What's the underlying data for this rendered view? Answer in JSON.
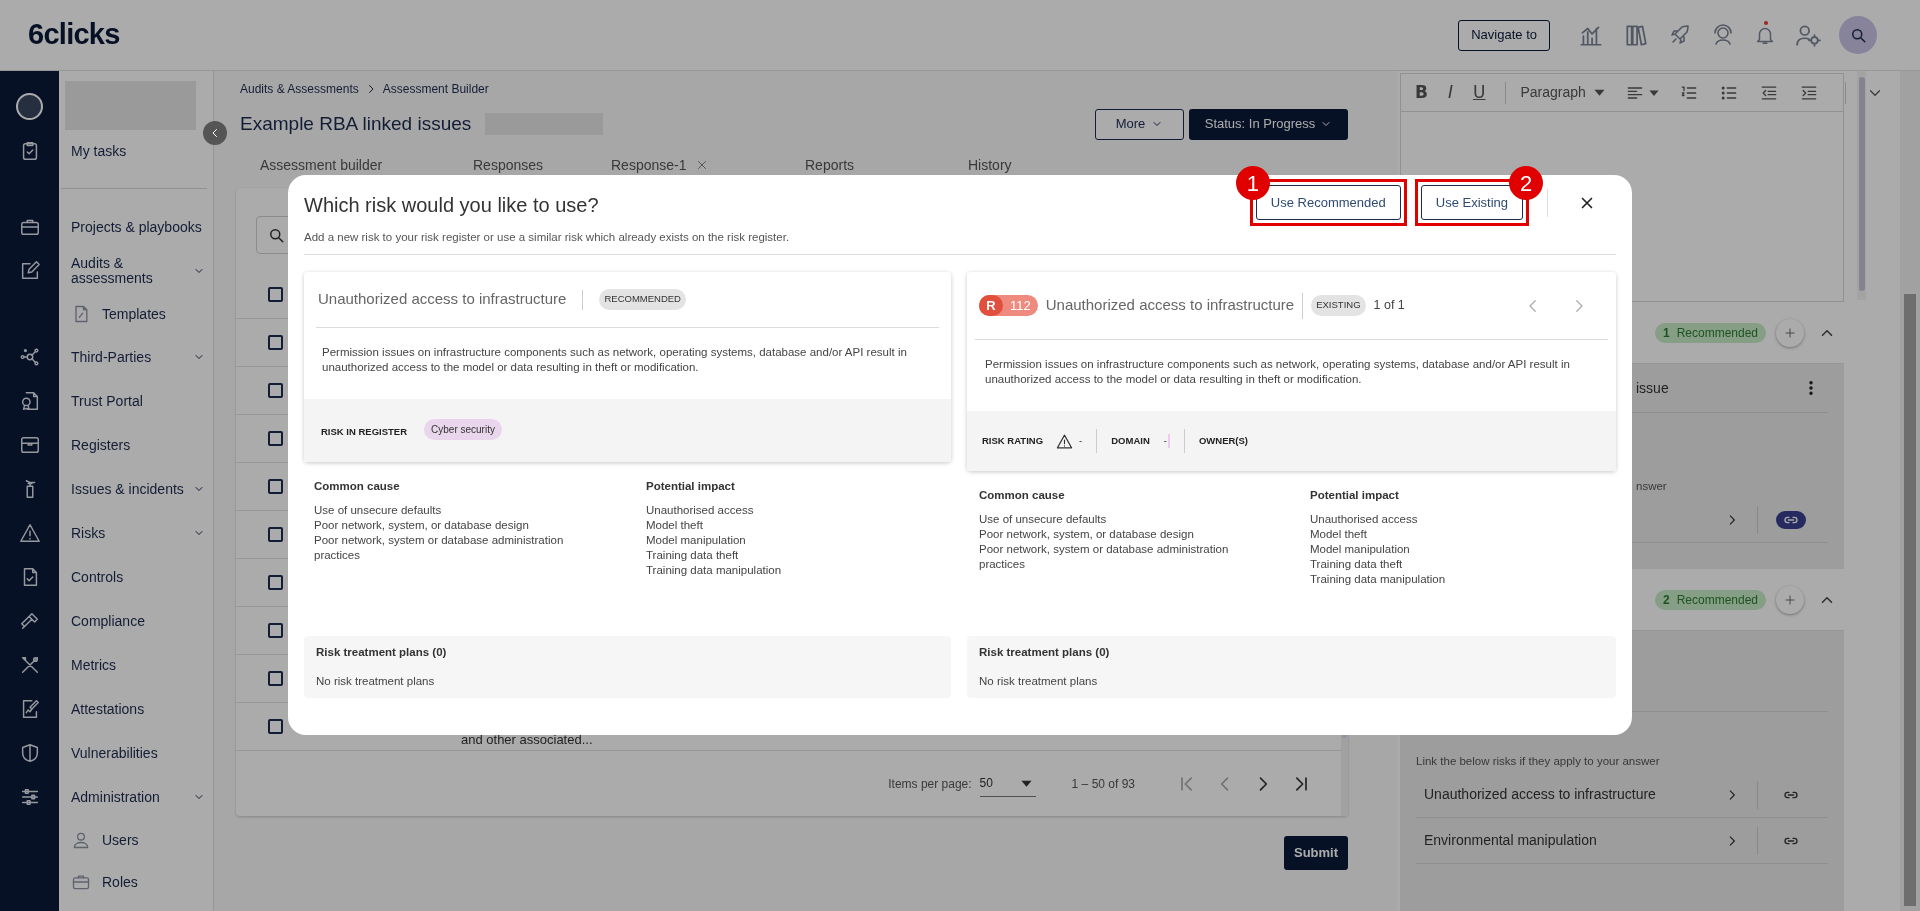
{
  "header": {
    "logo": "6clicks",
    "navigate_button": "Navigate to",
    "notifications_unread": true
  },
  "sidebar": {
    "items": [
      {
        "label": "My tasks",
        "expandable": false
      },
      {
        "label": "Projects & playbooks",
        "expandable": false
      },
      {
        "label": "Audits & assessments",
        "expandable": true,
        "children": [
          {
            "label": "Templates"
          }
        ]
      },
      {
        "label": "Third-Parties",
        "expandable": true
      },
      {
        "label": "Trust Portal",
        "expandable": false
      },
      {
        "label": "Registers",
        "expandable": false
      },
      {
        "label": "Issues & incidents",
        "expandable": true
      },
      {
        "label": "Risks",
        "expandable": true
      },
      {
        "label": "Controls",
        "expandable": false
      },
      {
        "label": "Compliance",
        "expandable": false
      },
      {
        "label": "Metrics",
        "expandable": false
      },
      {
        "label": "Attestations",
        "expandable": false
      },
      {
        "label": "Vulnerabilities",
        "expandable": false
      },
      {
        "label": "Administration",
        "expandable": true,
        "children": [
          {
            "label": "Users"
          },
          {
            "label": "Roles"
          }
        ]
      }
    ]
  },
  "breadcrumb": [
    "Audits & Assessments",
    "Assessment Builder"
  ],
  "page_title": "Example RBA linked issues",
  "actions": {
    "more": "More",
    "status": "Status: In Progress"
  },
  "tabs": [
    {
      "label": "Assessment builder",
      "closable": false
    },
    {
      "label": "Responses",
      "closable": false
    },
    {
      "label": "Response-1",
      "closable": true
    },
    {
      "label": "Reports",
      "closable": false
    },
    {
      "label": "History",
      "closable": false
    }
  ],
  "table": {
    "select_all": {
      "checked": false
    },
    "rows": [
      {
        "checked": false
      },
      {
        "checked": false
      },
      {
        "checked": false
      },
      {
        "checked": false
      },
      {
        "checked": false
      },
      {
        "checked": false
      },
      {
        "checked": false
      },
      {
        "checked": false
      },
      {
        "checked": false,
        "description": "and other associated..."
      }
    ]
  },
  "pagination": {
    "label": "Items per page:",
    "page_size": "50",
    "range": "1 – 50 of 93",
    "prev_enabled": false,
    "next_enabled": true
  },
  "submit": "Submit",
  "editor": {
    "format_buttons": [
      "B",
      "I",
      "U"
    ],
    "paragraph_style": "Paragraph"
  },
  "right_panel": {
    "sections": [
      {
        "count": "1",
        "label": "Recommended",
        "expanded": true,
        "title_fragment": "issue",
        "hint": "nswer",
        "risks": [
          {
            "linked": true
          }
        ]
      },
      {
        "count": "2",
        "label": "Recommended",
        "expanded": true,
        "hint": "Link the below risks if they apply to your answer",
        "risks": [
          {
            "label": "Unauthorized access to infrastructure",
            "linked": false
          },
          {
            "label": "Environmental manipulation",
            "linked": false
          }
        ]
      }
    ]
  },
  "modal": {
    "title": "Which risk would you like to use?",
    "subtitle": "Add a new risk to your risk register or use a similar risk which already exists on the risk register.",
    "buttons": [
      {
        "label": "Use Recommended",
        "callout": "1"
      },
      {
        "label": "Use Existing",
        "callout": "2"
      }
    ],
    "cards": [
      {
        "kind": "recommended",
        "title": "Unauthorized access to infrastructure",
        "badge": "RECOMMENDED",
        "description": "Permission issues on infrastructure components such as network, operating systems, database and/or API result in unauthorized access to the model or data resulting in theft or modification.",
        "register_label": "RISK IN REGISTER",
        "tag": "Cyber security",
        "common_cause": {
          "heading": "Common cause",
          "lines": [
            "Use of unsecure defaults",
            "Poor network, system, or database design",
            "Poor network, system or database administration practices"
          ]
        },
        "potential_impact": {
          "heading": "Potential impact",
          "lines": [
            "Unauthorised access",
            "Model theft",
            "Model manipulation",
            "Training data theft",
            "Training data manipulation"
          ]
        },
        "treatment": {
          "heading": "Risk treatment plans (0)",
          "empty": "No risk treatment plans"
        }
      },
      {
        "kind": "existing",
        "id_prefix": "R",
        "id_number": "112",
        "title": "Unauthorized access to infrastructure",
        "badge": "EXISTING",
        "pager": "1 of 1",
        "description": "Permission issues on infrastructure components such as network, operating systems, database and/or API result in unauthorized access to the model or data resulting in theft or modification.",
        "rating_label": "RISK RATING",
        "rating_value": "-",
        "domain_label": "DOMAIN",
        "domain_value": "-",
        "owners_label": "OWNER(S)",
        "common_cause": {
          "heading": "Common cause",
          "lines": [
            "Use of unsecure defaults",
            "Poor network, system, or database design",
            "Poor network, system or database administration practices"
          ]
        },
        "potential_impact": {
          "heading": "Potential impact",
          "lines": [
            "Unauthorised access",
            "Model theft",
            "Model manipulation",
            "Training data theft",
            "Training data manipulation"
          ]
        },
        "treatment": {
          "heading": "Risk treatment plans (0)",
          "empty": "No risk treatment plans"
        }
      }
    ]
  }
}
